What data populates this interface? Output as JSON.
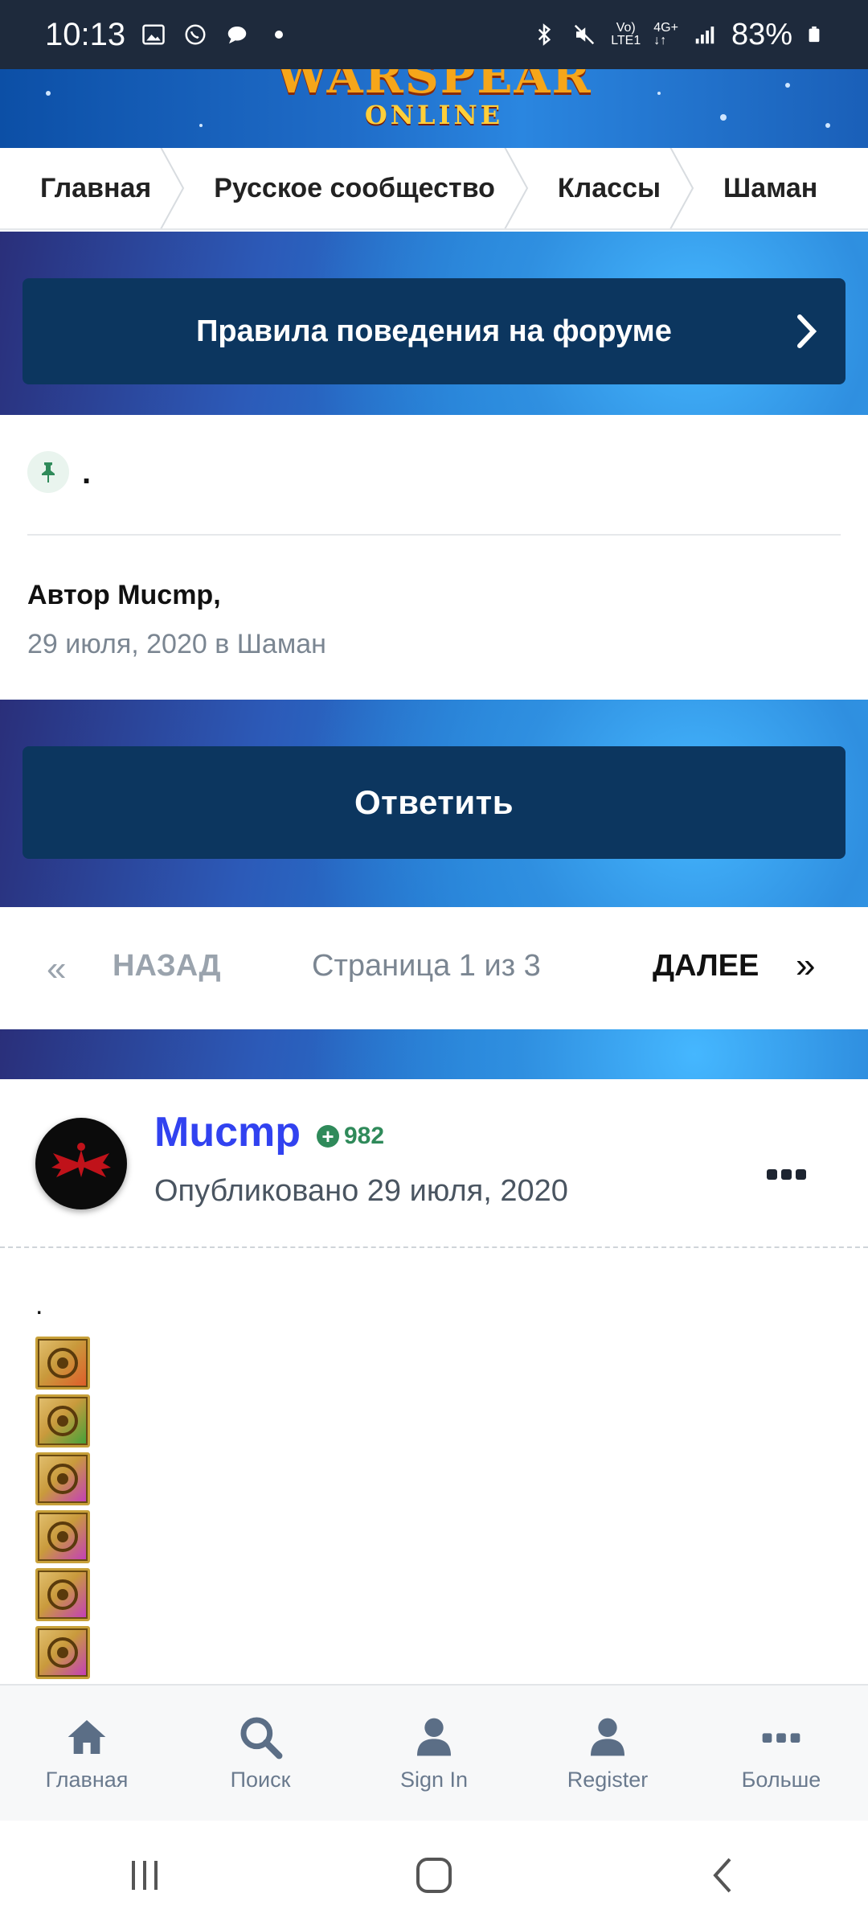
{
  "status_bar": {
    "time": "10:13",
    "battery": "83%",
    "network_label": "LTE1",
    "icons": [
      "image-icon",
      "viber-icon",
      "chat-icon",
      "dot-icon",
      "bluetooth-icon",
      "mute-icon",
      "volte-icon",
      "4g-icon",
      "signal-icon",
      "battery-icon"
    ]
  },
  "banner": {
    "logo_main": "WARSPEAR",
    "logo_sub": "ONLINE"
  },
  "breadcrumb": [
    "Главная",
    "Русское сообщество",
    "Классы",
    "Шаман"
  ],
  "rules_button": {
    "label": "Правила поведения на форуме"
  },
  "topic": {
    "title": ".",
    "author_prefix": "Автор",
    "author": "Mucmp,",
    "date_line": "29 июля, 2020 в Шаман"
  },
  "reply_button": {
    "label": "Ответить"
  },
  "pagination": {
    "prev_icon": "«",
    "prev_label": "НАЗАД",
    "info": "Страница 1 из 3",
    "next_label": "ДАЛЕЕ",
    "next_icon": "»"
  },
  "post": {
    "author": "Mucmp",
    "reputation": "982",
    "published": "Опубликовано 29 июля, 2020",
    "body_text": ".",
    "items": [
      {
        "name": "item-slot-icon",
        "bg": "#e05a2a"
      },
      {
        "name": "item-slot-icon",
        "bg": "#3ea23a"
      },
      {
        "name": "item-slot-icon",
        "bg": "#c43ac0"
      },
      {
        "name": "item-slot-icon",
        "bg": "#c43ac0"
      },
      {
        "name": "item-slot-icon",
        "bg": "#c43ac0"
      },
      {
        "name": "item-slot-icon",
        "bg": "#c43ac0"
      }
    ]
  },
  "bottom_nav": [
    {
      "label": "Главная",
      "icon": "home-icon"
    },
    {
      "label": "Поиск",
      "icon": "search-icon"
    },
    {
      "label": "Sign In",
      "icon": "user-icon"
    },
    {
      "label": "Register",
      "icon": "user-icon"
    },
    {
      "label": "Больше",
      "icon": "more-icon"
    }
  ],
  "colors": {
    "dark_button": "#0c365f",
    "author_link": "#3142f0",
    "reputation": "#2f8a5a",
    "status_bar": "#1e2a3c"
  }
}
